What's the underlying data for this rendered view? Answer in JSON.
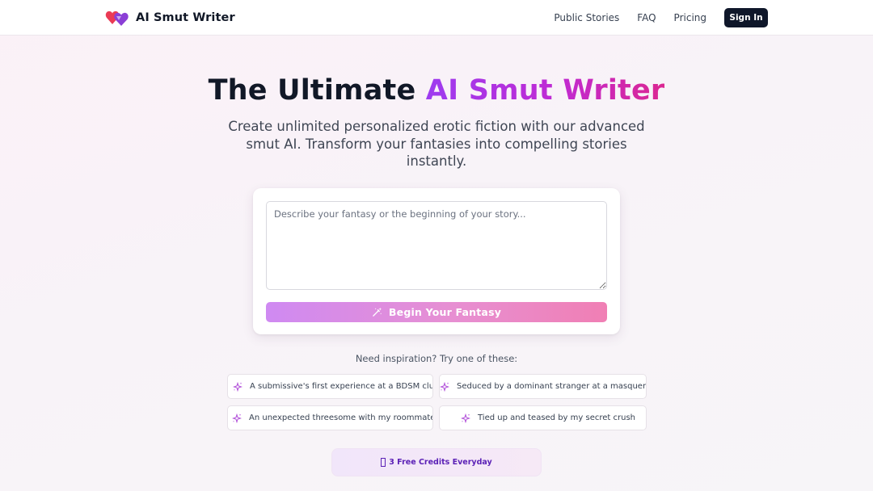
{
  "header": {
    "brand_name": "AI Smut Writer",
    "nav": [
      "Public Stories",
      "FAQ",
      "Pricing"
    ],
    "signin_label": "Sign In"
  },
  "hero": {
    "title_prefix": "The Ultimate ",
    "title_highlight": "AI Smut Writer",
    "subtitle": "Create unlimited personalized erotic fiction with our advanced smut AI. Transform your fantasies into compelling stories instantly."
  },
  "prompt_card": {
    "placeholder": "Describe your fantasy or the beginning of your story...",
    "value": "",
    "button_label": "Begin Your Fantasy"
  },
  "inspiration": {
    "label": "Need inspiration? Try one of these:",
    "chips": [
      "A submissive's first experience at a BDSM club",
      "Seduced by a dominant stranger at a masquerade ball",
      "An unexpected threesome with my roommates",
      "Tied up and teased by my secret crush"
    ]
  },
  "credits": {
    "label": "3 Free Credits Everyday"
  },
  "icons": {
    "logo": "hearts-logo-icon",
    "button": "magic-wand-icon",
    "chip": "sparkles-icon",
    "credits": "missing-glyph-icon"
  },
  "colors": {
    "accent_purple": "#9d3cf0",
    "accent_pink": "#db2792",
    "signin_bg": "#0f172a",
    "credits_text": "#5b21b6"
  }
}
